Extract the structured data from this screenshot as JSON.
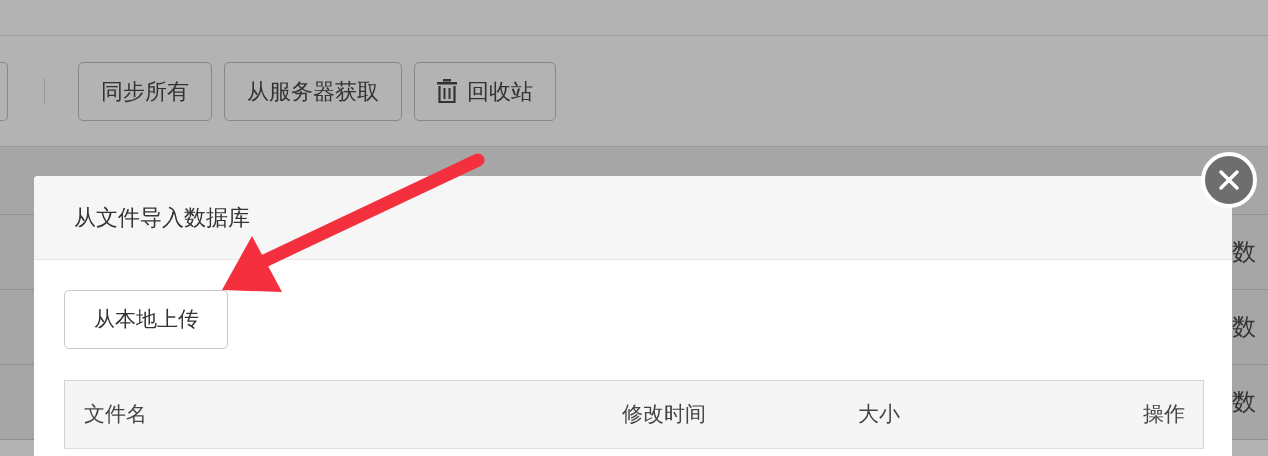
{
  "toolbar": {
    "buttons": [
      {
        "label": "同步所有",
        "kind": "text"
      },
      {
        "label": "从服务器获取",
        "kind": "text"
      },
      {
        "label": "回收站",
        "kind": "trash"
      }
    ]
  },
  "background_table": {
    "rows": [
      {
        "column_last": "数"
      },
      {
        "column_last": "数"
      },
      {
        "column_last": "数"
      }
    ]
  },
  "dialog": {
    "title": "从文件导入数据库",
    "upload_button": "从本地上传",
    "table": {
      "columns": [
        "文件名",
        "修改时间",
        "大小",
        "操作"
      ]
    }
  }
}
